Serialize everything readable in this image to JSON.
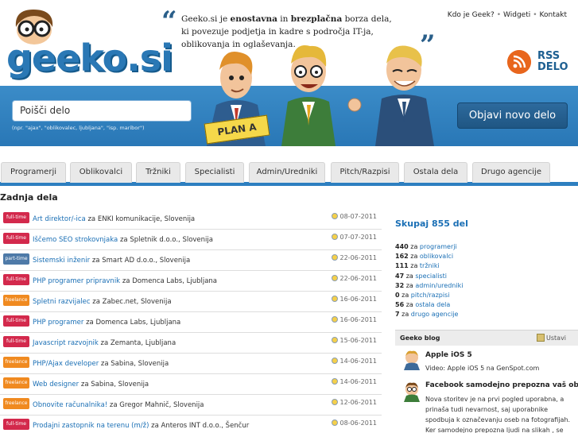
{
  "header": {
    "logo_text": "geeko.si",
    "tagline_parts": [
      "Geeko.si je ",
      "enostavna",
      " in ",
      "brezplačna",
      " borza dela, ki povezuje podjetja in kadre s področja IT-ja, oblikovanja in oglaševanja."
    ],
    "nav": [
      "Kdo je Geek?",
      "Widgeti",
      "Kontakt"
    ],
    "rss_line1": "RSS",
    "rss_line2": "DELO"
  },
  "search": {
    "placeholder": "Poišči delo",
    "hint": "(npr. \"ajax\", \"oblikovalec, ljubljana\", \"isp. maribor\")",
    "post_button": "Objavi novo delo"
  },
  "plan_sign": "PLAN A",
  "tabs": [
    "Programerji",
    "Oblikovalci",
    "Tržniki",
    "Specialisti",
    "Admin/Uredniki",
    "Pitch/Razpisi",
    "Ostala dela",
    "Drugo agencije"
  ],
  "section_title": "Zadnja dela",
  "jobs": [
    {
      "type": "full-time",
      "title": "Art direktor/-ica",
      "za": "za",
      "company": "ENKI komunikacije",
      "location": "Slovenija",
      "date": "08-07-2011"
    },
    {
      "type": "full-time",
      "title": "Iščemo SEO strokovnjaka",
      "za": "za",
      "company": "Spletnik d.o.o.",
      "location": "Slovenija",
      "date": "07-07-2011"
    },
    {
      "type": "part-time",
      "title": "Sistemski inženir",
      "za": "za",
      "company": "Smart AD d.o.o.",
      "location": "Slovenija",
      "date": "22-06-2011"
    },
    {
      "type": "full-time",
      "title": "PHP programer pripravnik",
      "za": "za",
      "company": "Domenca Labs",
      "location": "Ljubljana",
      "date": "22-06-2011"
    },
    {
      "type": "freelance",
      "title": "Spletni razvijalec",
      "za": "za",
      "company": "Zabec.net",
      "location": "Slovenija",
      "date": "16-06-2011"
    },
    {
      "type": "full-time",
      "title": "PHP programer",
      "za": "za",
      "company": "Domenca Labs",
      "location": "Ljubljana",
      "date": "16-06-2011"
    },
    {
      "type": "full-time",
      "title": "Javascript razvojnik",
      "za": "za",
      "company": "Zemanta",
      "location": "Ljubljana",
      "date": "15-06-2011"
    },
    {
      "type": "freelance",
      "title": "PHP/Ajax developer",
      "za": "za",
      "company": "Sabina",
      "location": "Slovenija",
      "date": "14-06-2011"
    },
    {
      "type": "freelance",
      "title": "Web designer",
      "za": "za",
      "company": "Sabina",
      "location": "Slovenija",
      "date": "14-06-2011"
    },
    {
      "type": "freelance",
      "title": "Obnovite računalnika!",
      "za": "za",
      "company": "Gregor Mahnič",
      "location": "Slovenija",
      "date": "12-06-2011"
    },
    {
      "type": "full-time",
      "title": "Prodajni zastopnik na terenu (m/ž)",
      "za": "za",
      "company": "Anteros INT d.o.o.",
      "location": "Šenčur",
      "date": "08-06-2011"
    }
  ],
  "stats": {
    "total": "Skupaj 855 del",
    "za": "za",
    "rows": [
      {
        "count": "440",
        "category": "programerji"
      },
      {
        "count": "162",
        "category": "oblikovalci"
      },
      {
        "count": "111",
        "category": "tržniki"
      },
      {
        "count": "47",
        "category": "specialisti"
      },
      {
        "count": "32",
        "category": "admin/uredniki"
      },
      {
        "count": "0",
        "category": "pitch/razpisi"
      },
      {
        "count": "56",
        "category": "ostala dela"
      },
      {
        "count": "7",
        "category": "drugo agencije"
      }
    ]
  },
  "blog": {
    "title": "Geeko blog",
    "pause": "Ustavi",
    "post1_title": "Apple iOS 5",
    "post1_text": "Video: Apple iOS 5 na GenSpot.com",
    "post2_title": "Facebook samodejno prepozna vaš obraz",
    "post2_text": "Nova storitev je na prvi pogled uporabna, a prinaša tudi nevarnost, saj uporabnike spodbuja k označevanju oseb na fotografijah. Ker samodejno prepozna ljudi na slikah , se bodo uporabniki zagotovo posvetili"
  },
  "colors": {
    "band": "#2d7fc0",
    "link": "#1a6fb5",
    "full_time": "#d3294c",
    "part_time": "#4e7aa8",
    "freelance": "#f08a20"
  }
}
